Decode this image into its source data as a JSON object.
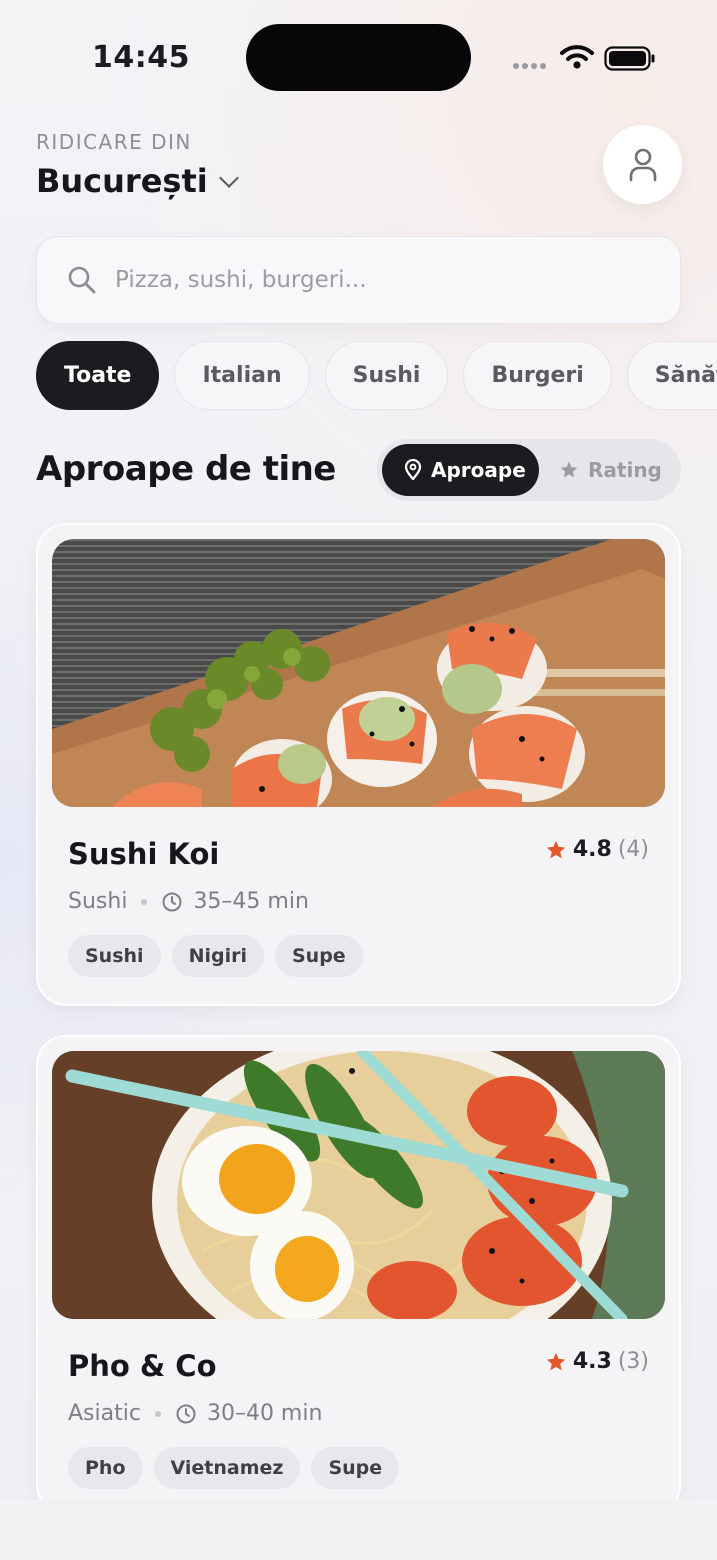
{
  "status_bar": {
    "time": "14:45"
  },
  "header": {
    "pickup_label": "RIDICARE DIN",
    "city": "București"
  },
  "search": {
    "placeholder": "Pizza, sushi, burgeri..."
  },
  "categories": [
    "Toate",
    "Italian",
    "Sushi",
    "Burgeri",
    "Sănătos"
  ],
  "section": {
    "title": "Aproape de tine",
    "sort_options": [
      "Aproape",
      "Rating"
    ],
    "sort_selected": "Aproape"
  },
  "restaurants": [
    {
      "name": "Sushi Koi",
      "rating": "4.8",
      "reviews": "(4)",
      "cuisine": "Sushi",
      "time": "35–45 min",
      "tags": [
        "Sushi",
        "Nigiri",
        "Supe"
      ]
    },
    {
      "name": "Pho & Co",
      "rating": "4.3",
      "reviews": "(3)",
      "cuisine": "Asiatic",
      "time": "30–40 min",
      "tags": [
        "Pho",
        "Vietnamez",
        "Supe"
      ]
    }
  ],
  "colors": {
    "primary_dark": "#1c1c20",
    "star": "#e4572e",
    "background": "#f1f1f5"
  }
}
